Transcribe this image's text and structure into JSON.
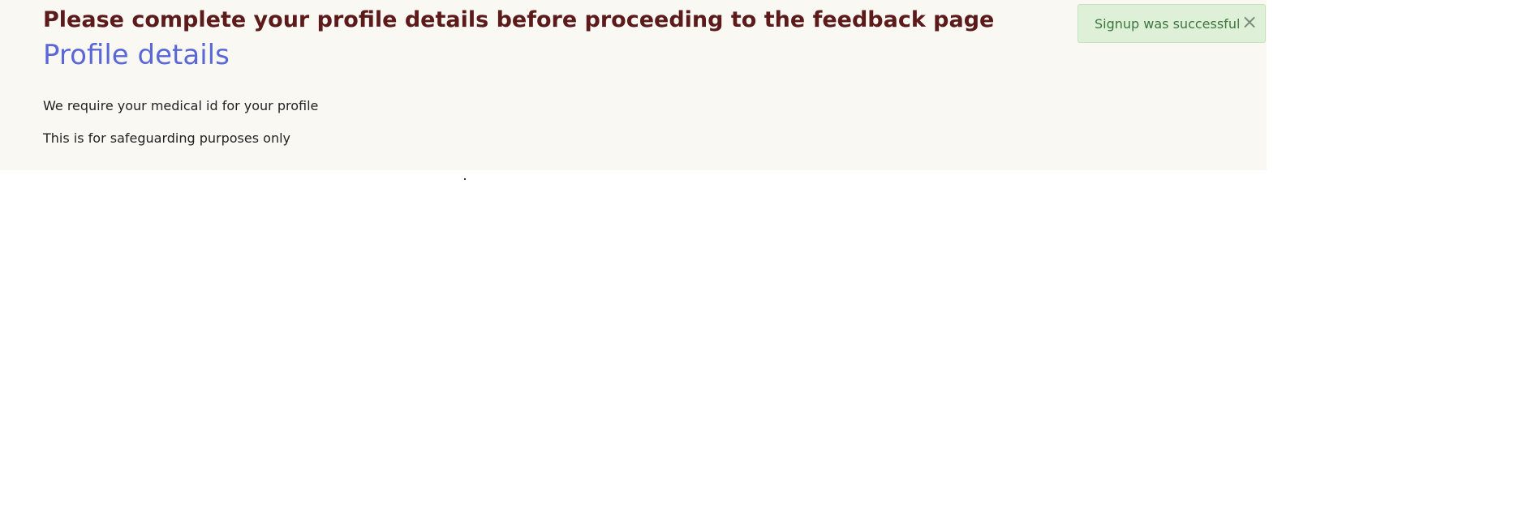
{
  "page": {
    "heading": "Please complete your profile details before proceeding to the feedback page",
    "title": "Profile details",
    "paragraphs": [
      "We require your medical id for your profile",
      "This is for safeguarding purposes only"
    ]
  },
  "alert": {
    "message": "Signup was successful",
    "close_icon": "×"
  },
  "colors": {
    "heading": "#5c1a1a",
    "title": "#5a67d8",
    "banner_bg": "#faf8f3",
    "alert_bg": "#dff0d8",
    "alert_text": "#3c763d"
  },
  "icons": {
    "close": "close-icon"
  }
}
